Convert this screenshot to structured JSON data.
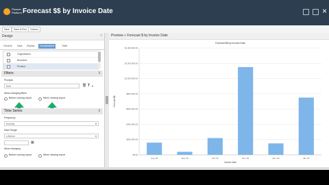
{
  "app": {
    "title": "Forecast $$ by Invoice Date",
    "logo_text": "Planner Platform"
  },
  "toolbar": {
    "buttons": [
      "Save",
      "Save & Run",
      "Column"
    ]
  },
  "design": {
    "title": "Design",
    "collapse_icon": "chevron-left-icon",
    "tabs": [
      "General",
      "Data",
      "Display",
      "Visualizations",
      "Table"
    ],
    "active_tab": "Visualizations",
    "fields": [
      "Organization",
      "Business",
      "Product"
    ]
  },
  "filters": {
    "title": "Filters",
    "prompt_label": "Prompts",
    "prompt_value": "Now",
    "allow_label": "Allow changing filters",
    "before_label": "Before running report",
    "when_label": "When viewing report"
  },
  "time_series": {
    "title": "Time Series",
    "frequency_label": "Frequency",
    "frequency_value": "Monthly",
    "date_range_label": "Date Range",
    "date_range_value": "a Before",
    "allow_label": "Allow changing",
    "before_label": "Before running report",
    "when_label": "When viewing report"
  },
  "preview": {
    "title": "Preview",
    "subtitle": "Forecast $ by Invoice Date"
  },
  "chart_data": {
    "type": "bar",
    "title": "Forecast $$ by Invoice Date",
    "xlabel": "Invoice Date",
    "ylabel": "Forecast $$",
    "categories": [
      "Aug '20",
      "Sep '20",
      "Oct '20",
      "Nov '20",
      "Dec '20",
      "Jan '21"
    ],
    "values": [
      160000,
      40000,
      220000,
      1150000,
      150000,
      750000
    ],
    "ylim": [
      0,
      1400000
    ],
    "yticks": [
      "$0.00",
      "$200,000.00",
      "$400,000.00",
      "$600,000.00",
      "$800,000.00",
      "$1,000,000.00",
      "$1,200,000.00",
      "$1,400,000.00"
    ],
    "color": "#7eb6ea",
    "grid": true
  }
}
